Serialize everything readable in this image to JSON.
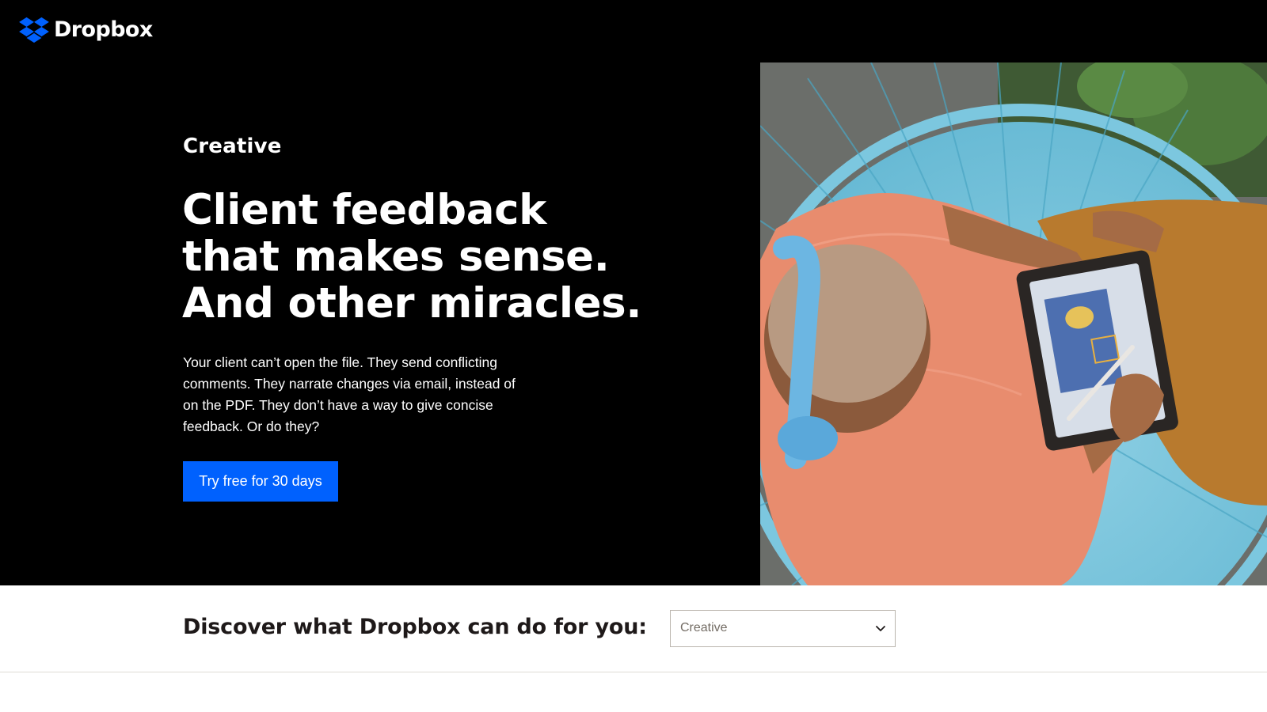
{
  "brand": {
    "name": "Dropbox",
    "logo_icon": "dropbox-box-icon",
    "accent_color": "#0061fe"
  },
  "hero": {
    "eyebrow": "Creative",
    "headline_lines": [
      "Client feedback",
      "that makes sense.",
      "And other miracles."
    ],
    "body": "Your client can’t open the file. They send conflicting comments. They narrate changes via email, instead of on the PDF. They don’t have a way to give concise feedback. Or do they?",
    "cta_label": "Try free for 30 days"
  },
  "discover": {
    "title": "Discover what Dropbox can do for you:",
    "select": {
      "value": "Creative",
      "icon": "chevron-down-icon"
    }
  }
}
